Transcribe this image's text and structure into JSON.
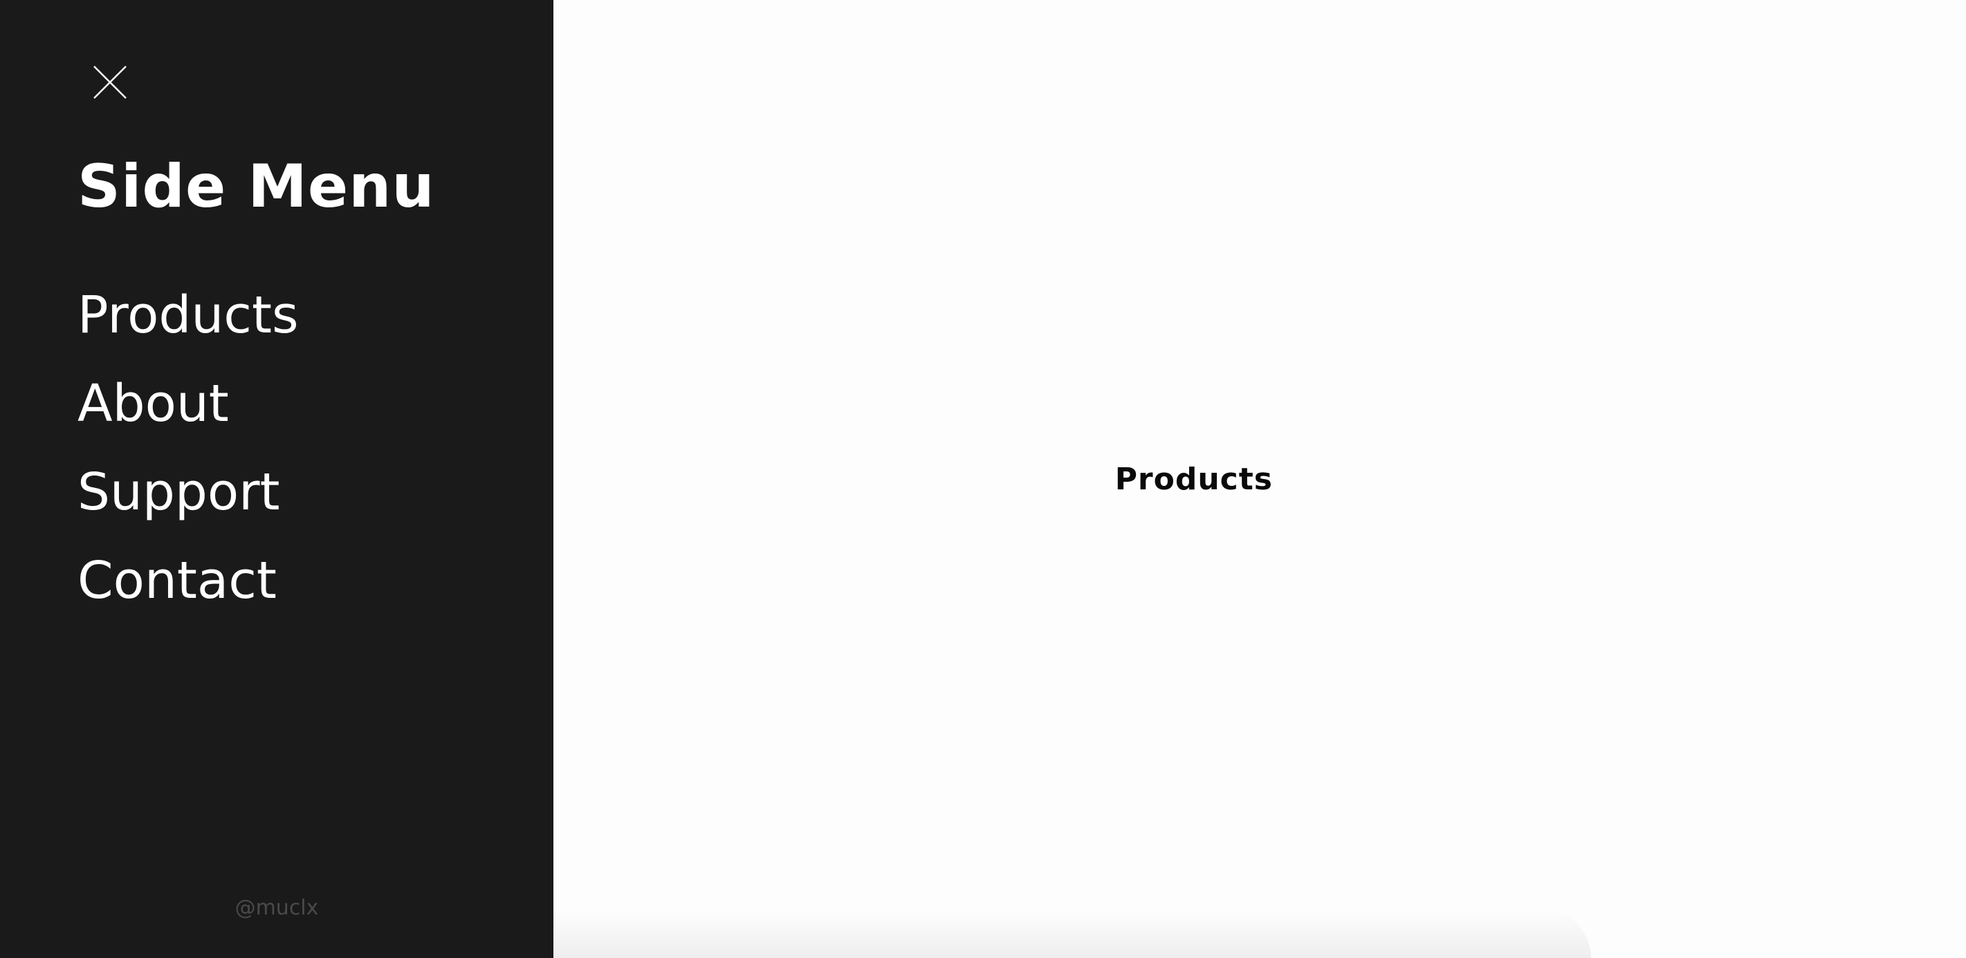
{
  "sidebar": {
    "title": "Side Menu",
    "close_icon": "close-icon",
    "items": [
      {
        "label": "Products"
      },
      {
        "label": "About"
      },
      {
        "label": "Support"
      },
      {
        "label": "Contact"
      }
    ],
    "credit": "@muclx",
    "background_color": "#1a1a1a",
    "text_color": "#ffffff"
  },
  "main": {
    "title": "Products",
    "background_color": "#fdfdfd"
  }
}
